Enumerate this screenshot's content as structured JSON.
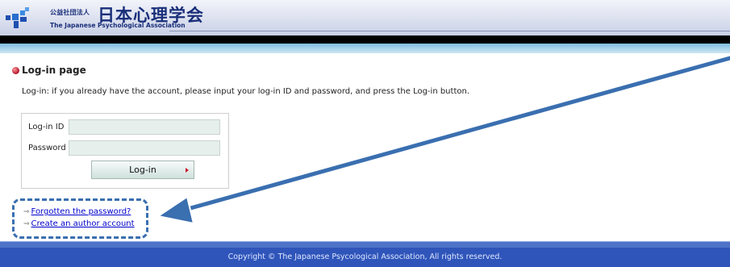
{
  "header": {
    "org_prefix": "公益社団法人",
    "org_name": "日本心理学会",
    "org_name_en": "The Japanese Psychological Association"
  },
  "page": {
    "title": "Log-in page",
    "description": "Log-in: if you already have the account, please input your log-in ID and password, and press the Log-in button."
  },
  "login_form": {
    "id_label": "Log-in ID",
    "id_value": "",
    "password_label": "Password",
    "password_value": "",
    "button_label": "Log-in"
  },
  "links": {
    "forgot_password": "Forgotten the password?",
    "create_account": "Create an author account"
  },
  "footer": {
    "copyright": "Copyright © The Japanese Psycological Association, All rights reserved."
  },
  "colors": {
    "header_text": "#1a2f7a",
    "annotation": "#3a6fb0",
    "footer_bg": "#2f55ba",
    "link": "#0000cc"
  }
}
